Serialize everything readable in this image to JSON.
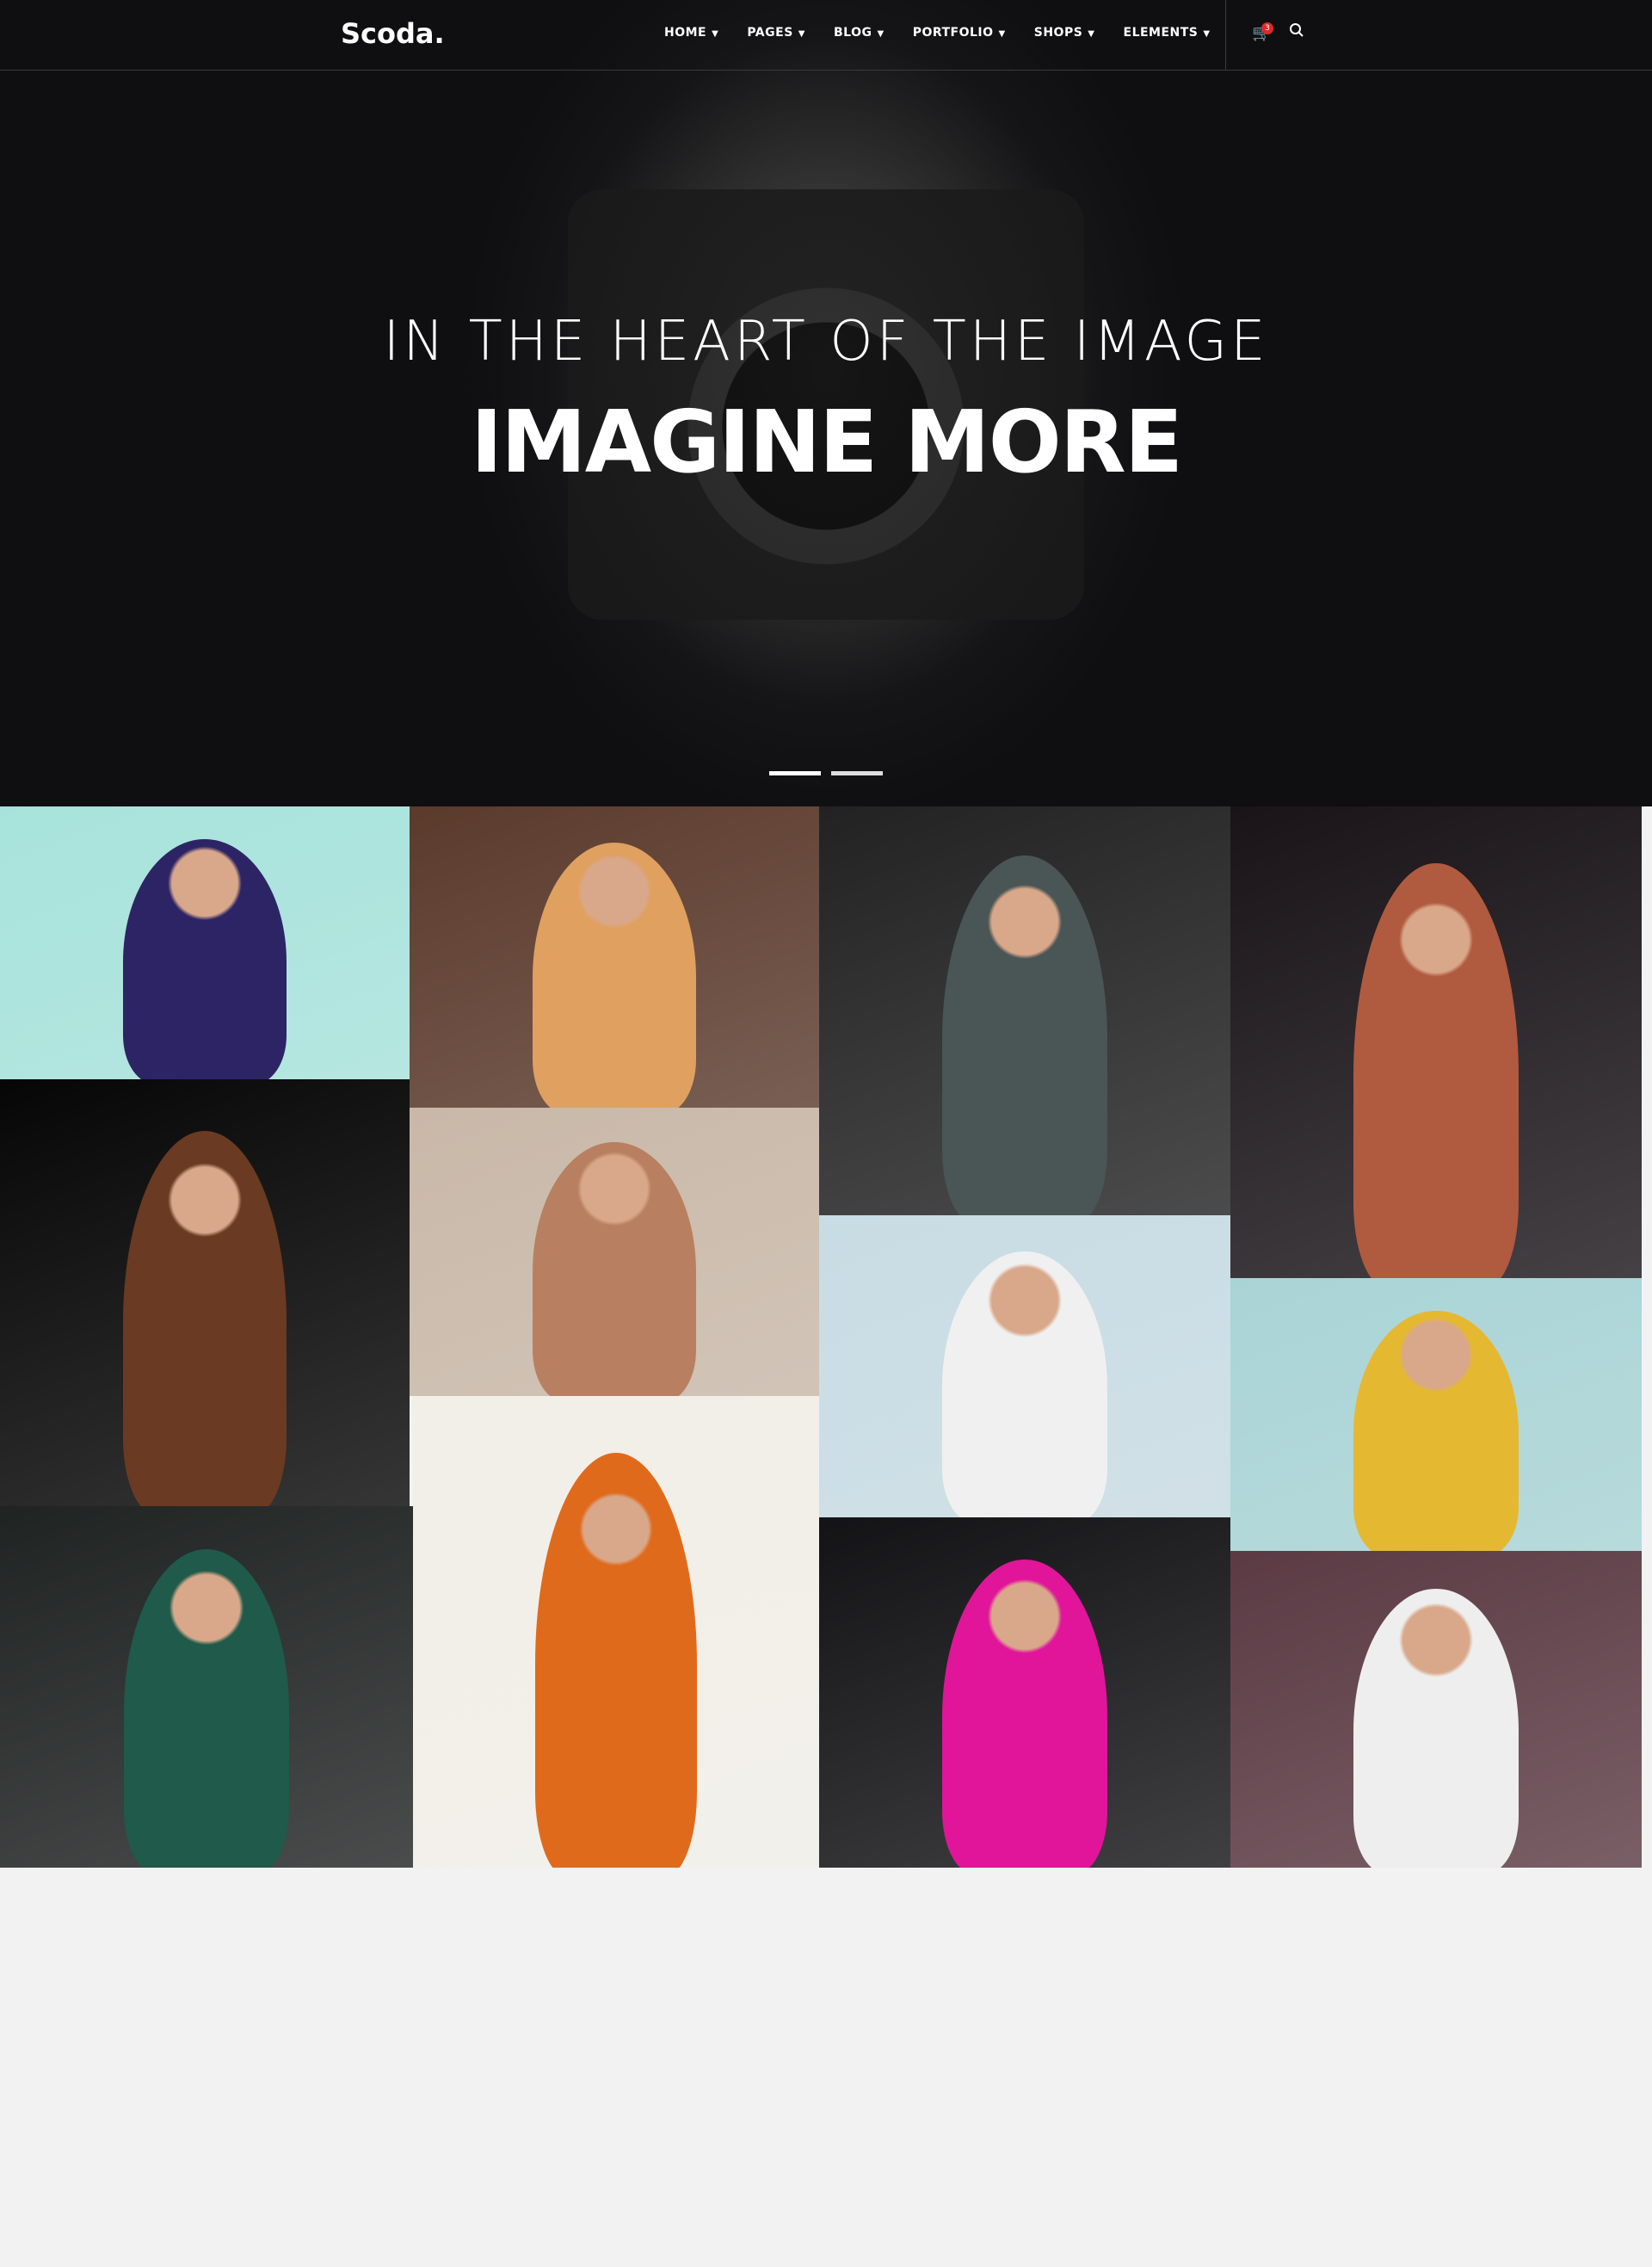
{
  "header": {
    "logo": "Scoda.",
    "nav": [
      {
        "label": "HOME"
      },
      {
        "label": "PAGES"
      },
      {
        "label": "BLOG"
      },
      {
        "label": "PORTFOLIO"
      },
      {
        "label": "SHOPS"
      },
      {
        "label": "ELEMENTS"
      }
    ],
    "cart_count": "3",
    "chevron": "⌄"
  },
  "hero": {
    "subtitle": "IN THE HEART OF THE IMAGE",
    "title": "IMAGINE MORE",
    "slides": 2,
    "active_slide": 1
  },
  "gallery": [
    {
      "name": "woman-lace-dress",
      "bg": "#a7e3dc",
      "fig": "#2d2466"
    },
    {
      "name": "woman-red-hair-brick",
      "bg": "#5b3a2c",
      "fig": "#e0a060"
    },
    {
      "name": "man-glasses-dark",
      "bg": "#222222",
      "fig": "#4a5555"
    },
    {
      "name": "woman-neon-sunglasses",
      "bg": "#1a1418",
      "fig": "#b05a40"
    },
    {
      "name": "bearded-man",
      "bg": "#060606",
      "fig": "#6b3a22"
    },
    {
      "name": "woman-sweater",
      "bg": "#c9b8a8",
      "fig": "#b88060"
    },
    {
      "name": "man-sound-guy-shirt",
      "bg": "#c8dce4",
      "fig": "#f0f0f0"
    },
    {
      "name": "woman-yellow-shirt",
      "bg": "#a9d4d6",
      "fig": "#e5b832"
    },
    {
      "name": "woman-face-paint",
      "bg": "#1f2322",
      "fig": "#1f5a4a"
    },
    {
      "name": "man-orange-chair",
      "bg": "#f2efe8",
      "fig": "#e06a1c"
    },
    {
      "name": "woman-pink-dress",
      "bg": "#131316",
      "fig": "#e0159a"
    },
    {
      "name": "woman-white-dress-forest",
      "bg": "#5b3a44",
      "fig": "#eeeeee"
    }
  ]
}
